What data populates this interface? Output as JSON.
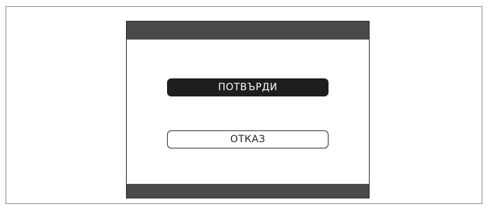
{
  "dialog": {
    "confirm_label": "ПОТВЪРДИ",
    "cancel_label": "ОТКАЗ"
  },
  "colors": {
    "bar": "#4a4a4a",
    "confirm_bg": "#1e1e1e",
    "confirm_text": "#ffffff",
    "cancel_bg": "#ffffff",
    "cancel_text": "#1e1e1e"
  }
}
